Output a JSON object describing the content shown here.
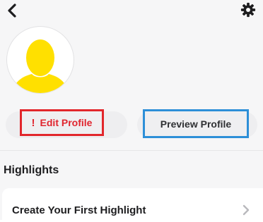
{
  "header": {
    "back_icon": "chevron-left-icon",
    "settings_icon": "gear-icon"
  },
  "profile": {
    "avatar_icon": "default-avatar-silhouette",
    "avatar_color": "#FFE000"
  },
  "actions": {
    "edit_profile_alert": "!",
    "edit_profile_label": "Edit Profile",
    "preview_profile_label": "Preview Profile",
    "edit_color": "#E0252E",
    "edit_highlight_border": "#E2262B",
    "preview_highlight_border": "#2D8FD8"
  },
  "highlights": {
    "section_title": "Highlights",
    "items": [
      {
        "label": "Create Your First Highlight",
        "icon": "chevron-right-icon"
      }
    ]
  }
}
